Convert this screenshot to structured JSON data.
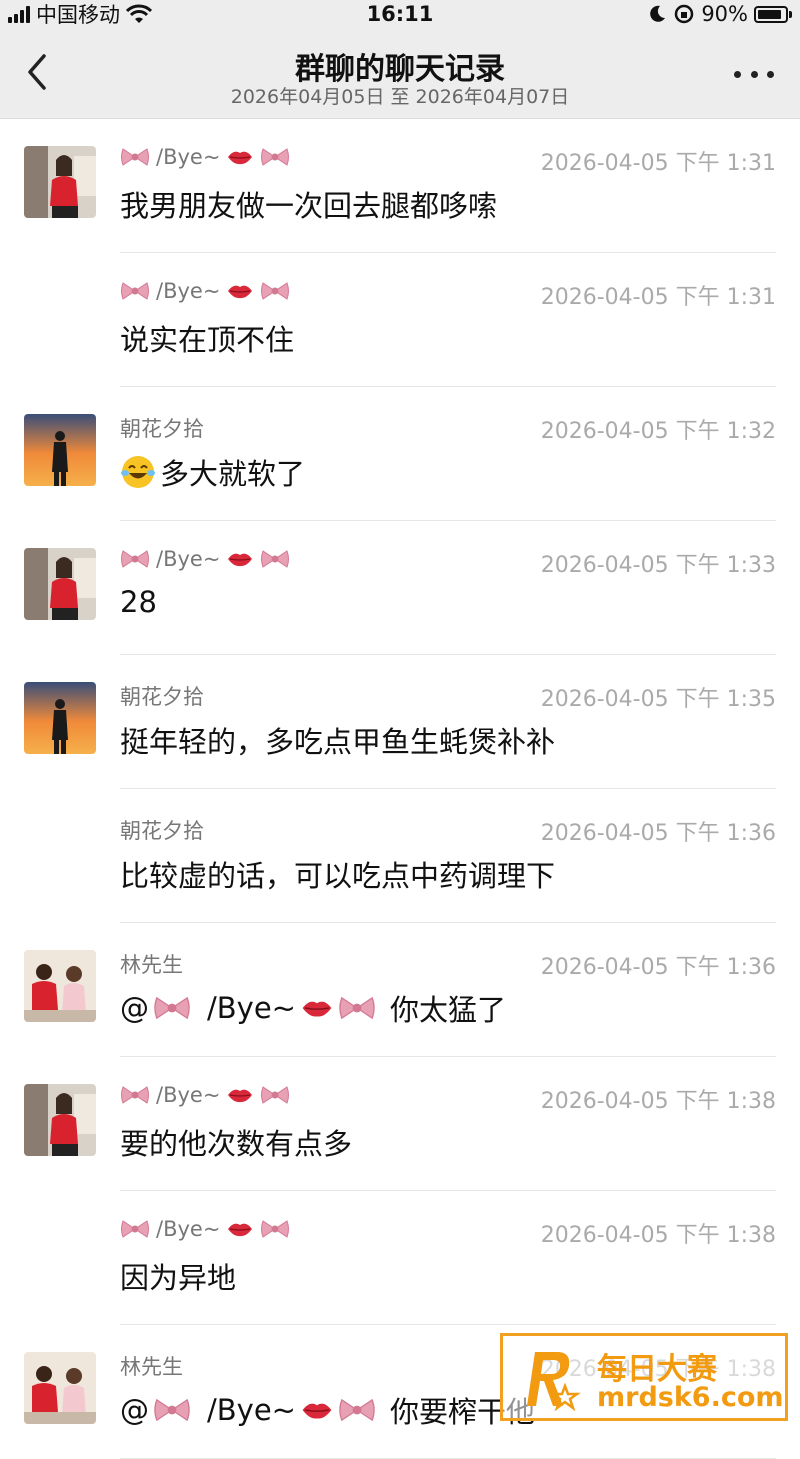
{
  "status_bar": {
    "carrier": "中国移动",
    "time": "16:11",
    "battery": "90%",
    "battery_level": 0.9,
    "icons": [
      "signal-icon",
      "wifi-icon",
      "moon-icon",
      "orientation-lock-icon",
      "battery-icon"
    ]
  },
  "header": {
    "title": "群聊的聊天记录",
    "subtitle": "2026年04月05日 至 2026年04月07日",
    "back_icon": "chevron-left-icon",
    "more_icon": "more-icon"
  },
  "messages": [
    {
      "sender": "/Bye~",
      "sender_decor": "bow-lips",
      "time": "2026-04-05 下午 1:31",
      "text": "我男朋友做一次回去腿都哆嗦",
      "avatar": "woman"
    },
    {
      "sender": "/Bye~",
      "sender_decor": "bow-lips",
      "time": "2026-04-05 下午 1:31",
      "text": "说实在顶不住",
      "avatar": ""
    },
    {
      "sender": "朝花夕拾",
      "sender_decor": "",
      "time": "2026-04-05 下午 1:32",
      "text": "多大就软了",
      "text_prefix_emoji": "laughing-tears",
      "avatar": "sunset"
    },
    {
      "sender": "/Bye~",
      "sender_decor": "bow-lips",
      "time": "2026-04-05 下午 1:33",
      "text": "28",
      "avatar": "woman"
    },
    {
      "sender": "朝花夕拾",
      "sender_decor": "",
      "time": "2026-04-05 下午 1:35",
      "text": "挺年轻的，多吃点甲鱼生蚝煲补补",
      "avatar": "sunset"
    },
    {
      "sender": "朝花夕拾",
      "sender_decor": "",
      "time": "2026-04-05 下午 1:36",
      "text": "比较虚的话，可以吃点中药调理下",
      "avatar": ""
    },
    {
      "sender": "林先生",
      "sender_decor": "",
      "time": "2026-04-05 下午 1:36",
      "text_mention": "@",
      "mention_name": "/Bye~",
      "text": "你太猛了",
      "avatar": "couple"
    },
    {
      "sender": "/Bye~",
      "sender_decor": "bow-lips",
      "time": "2026-04-05 下午 1:38",
      "text": "要的他次数有点多",
      "avatar": "woman"
    },
    {
      "sender": "/Bye~",
      "sender_decor": "bow-lips",
      "time": "2026-04-05 下午 1:38",
      "text": "因为异地",
      "avatar": ""
    },
    {
      "sender": "林先生",
      "sender_decor": "",
      "time": "2026-04-05 下午 1:38",
      "text_mention": "@",
      "mention_name": "/Bye~",
      "text": "你要榨干他",
      "avatar": "couple"
    }
  ],
  "watermark": {
    "line1": "每日大赛",
    "line2": "mrdsk6.com",
    "brand_color": "#f29a10"
  }
}
